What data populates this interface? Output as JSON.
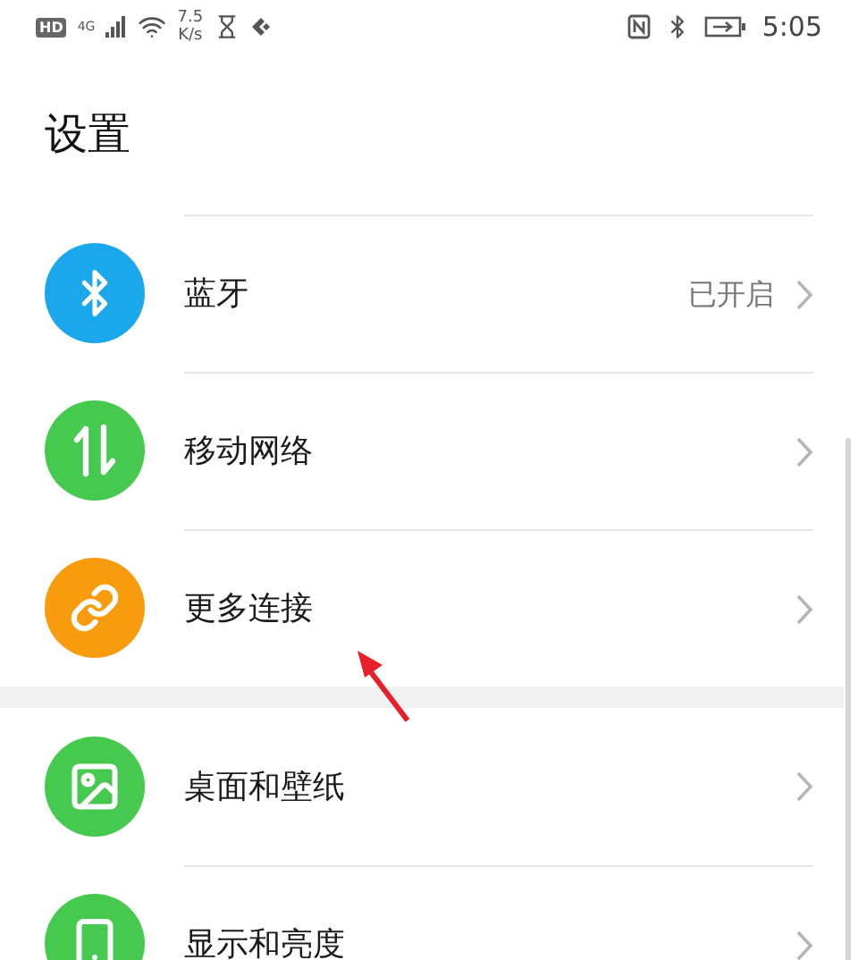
{
  "status_bar": {
    "hd": "HD",
    "network": "4G",
    "speed": "7.5",
    "speed_unit": "K/s",
    "time": "5:05"
  },
  "title": "设置",
  "groups": [
    {
      "items": [
        {
          "kind": "bluetooth",
          "color": "#1aa7ec",
          "label": "蓝牙",
          "value": "已开启"
        },
        {
          "kind": "mobile",
          "color": "#45c94e",
          "label": "移动网络"
        },
        {
          "kind": "link",
          "color": "#f89b0c",
          "label": "更多连接"
        }
      ]
    },
    {
      "items": [
        {
          "kind": "wallpaper",
          "color": "#45c94e",
          "label": "桌面和壁纸"
        },
        {
          "kind": "display",
          "color": "#45c94e",
          "label": "显示和亮度"
        }
      ]
    }
  ]
}
